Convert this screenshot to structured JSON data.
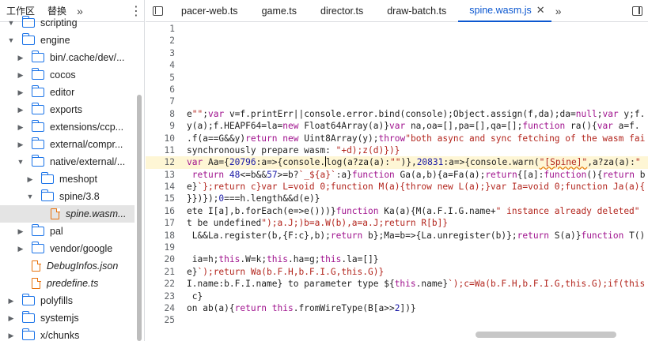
{
  "navigator": {
    "tabs": [
      "工作区",
      "替换"
    ],
    "more_icon": "chevron-double-right-icon",
    "menu_icon": "kebab-menu-icon",
    "tree": [
      {
        "label": "scripting",
        "type": "folder",
        "level": 0,
        "arrow": "down"
      },
      {
        "label": "engine",
        "type": "folder",
        "level": 0,
        "arrow": "down"
      },
      {
        "label": "bin/.cache/dev/...",
        "type": "folder",
        "level": 1,
        "arrow": "right"
      },
      {
        "label": "cocos",
        "type": "folder",
        "level": 1,
        "arrow": "right"
      },
      {
        "label": "editor",
        "type": "folder",
        "level": 1,
        "arrow": "right"
      },
      {
        "label": "exports",
        "type": "folder",
        "level": 1,
        "arrow": "right"
      },
      {
        "label": "extensions/ccp...",
        "type": "folder",
        "level": 1,
        "arrow": "right"
      },
      {
        "label": "external/compr...",
        "type": "folder",
        "level": 1,
        "arrow": "right"
      },
      {
        "label": "native/external/...",
        "type": "folder",
        "level": 1,
        "arrow": "down"
      },
      {
        "label": "meshopt",
        "type": "folder",
        "level": 2,
        "arrow": "right"
      },
      {
        "label": "spine/3.8",
        "type": "folder",
        "level": 2,
        "arrow": "down"
      },
      {
        "label": "spine.wasm...",
        "type": "file",
        "level": 3,
        "arrow": "",
        "selected": true,
        "italic": true
      },
      {
        "label": "pal",
        "type": "folder",
        "level": 1,
        "arrow": "right"
      },
      {
        "label": "vendor/google",
        "type": "folder",
        "level": 1,
        "arrow": "right"
      },
      {
        "label": "DebugInfos.json",
        "type": "file",
        "level": 1,
        "arrow": "",
        "italic": true
      },
      {
        "label": "predefine.ts",
        "type": "file",
        "level": 1,
        "arrow": "",
        "italic": true
      },
      {
        "label": "polyfills",
        "type": "folder",
        "level": 0,
        "arrow": "right"
      },
      {
        "label": "systemjs",
        "type": "folder",
        "level": 0,
        "arrow": "right"
      },
      {
        "label": "x/chunks",
        "type": "folder",
        "level": 0,
        "arrow": "right"
      }
    ]
  },
  "editor": {
    "tabs": [
      {
        "label": "pacer-web.ts",
        "active": false
      },
      {
        "label": "game.ts",
        "active": false
      },
      {
        "label": "director.ts",
        "active": false
      },
      {
        "label": "draw-batch.ts",
        "active": false
      },
      {
        "label": "spine.wasm.js",
        "active": true
      }
    ],
    "close_icon": "close-icon",
    "more_tabs_icon": "chevron-double-right-icon",
    "left_toggle_icon": "sidebar-toggle-icon",
    "right_toggle_icon": "dock-toggle-icon",
    "lines": [
      {
        "n": "1",
        "text": ""
      },
      {
        "n": "2",
        "text": ""
      },
      {
        "n": "3",
        "text": ""
      },
      {
        "n": "4",
        "text": ""
      },
      {
        "n": "5",
        "text": ""
      },
      {
        "n": "6",
        "text": ""
      },
      {
        "n": "7",
        "text": ""
      },
      {
        "n": "8",
        "text": "e\"\";var v=f.printErr||console.error.bind(console);Object.assign(f,da);da=null;var y;f."
      },
      {
        "n": "9",
        "text": "y(a);f.HEAPF64=la=new Float64Array(a)}var na,oa=[],pa=[],qa=[];function ra(){var a=f."
      },
      {
        "n": "10",
        "text": ".f(a==G&&y)return new Uint8Array(y);throw\"both async and sync fetching of the wasm fai"
      },
      {
        "n": "11",
        "text": "synchronously prepare wasm: \"+d);z(d)})}"
      },
      {
        "n": "12",
        "text": "var Aa={20796:a=>{console.log(a?za(a):\"\")},20831:a=>{console.warn(\"[Spine]\",a?za(a):\"",
        "highlight": true
      },
      {
        "n": "13",
        "text": " return 48<=b&&57>=b?`_${a}`:a}function Ga(a,b){a=Fa(a);return{[a]:function(){return b"
      },
      {
        "n": "14",
        "text": "e}`};return c}var L=void 0;function M(a){throw new L(a);}var Ia=void 0;function Ja(a){"
      },
      {
        "n": "15",
        "text": "}})});0===h.length&&d(e)}"
      },
      {
        "n": "16",
        "text": "ete I[a],b.forEach(e=>e()))}function Ka(a){M(a.F.I.G.name+\" instance already deleted\""
      },
      {
        "n": "17",
        "text": "t be undefined\");a.J;)b=a.W(b),a=a.J;return R[b]}"
      },
      {
        "n": "18",
        "text": " L&&La.register(b,{F:c},b);return b};Ma=b=>{La.unregister(b)};return S(a)}function T()"
      },
      {
        "n": "19",
        "text": ""
      },
      {
        "n": "20",
        "text": " ia=h;this.W=k;this.ha=g;this.la=[]}"
      },
      {
        "n": "21",
        "text": "e}`);return Wa(b.F.H,b.F.I.G,this.G)}"
      },
      {
        "n": "22",
        "text": "I.name:b.F.I.name} to parameter type ${this.name}`);c=Wa(b.F.H,b.F.I.G,this.G);if(this"
      },
      {
        "n": "23",
        "text": " c}"
      },
      {
        "n": "24",
        "text": "on ab(a){return this.fromWireType(B[a>>2])}"
      },
      {
        "n": "25",
        "text": ""
      }
    ]
  }
}
